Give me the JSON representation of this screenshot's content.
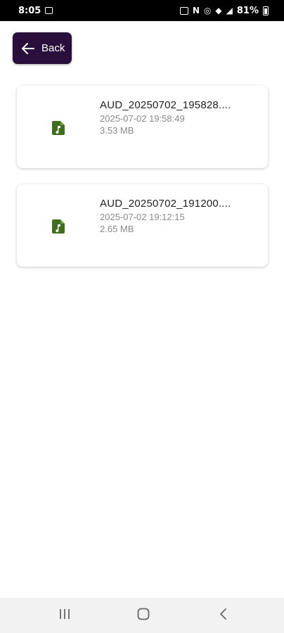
{
  "status_bar": {
    "time": "8:05",
    "battery": "81%"
  },
  "back_button": {
    "label": "Back",
    "icon": "arrow-left-icon"
  },
  "files": [
    {
      "name": "AUD_20250702_195828....",
      "date": "2025-07-02 19:58:49",
      "size": "3.53 MB",
      "icon": "audio-file-icon"
    },
    {
      "name": "AUD_20250702_191200....",
      "date": "2025-07-02 19:12:15",
      "size": "2.65 MB",
      "icon": "audio-file-icon"
    }
  ],
  "nav_bar": {
    "buttons": [
      "recent-apps-icon",
      "home-icon",
      "back-nav-icon"
    ]
  },
  "colors": {
    "back_button_bg": "#2a0f3c",
    "file_icon": "#3f6e1c",
    "secondary_text": "#8a8a8a"
  }
}
